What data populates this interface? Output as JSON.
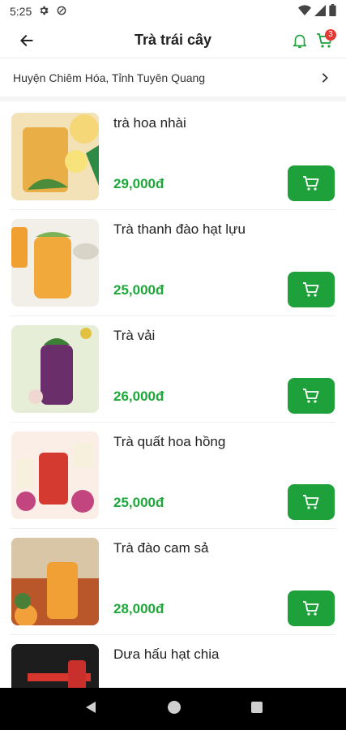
{
  "status_bar": {
    "time": "5:25"
  },
  "header": {
    "title": "Trà trái cây",
    "cart_count": "3"
  },
  "location": {
    "text": "Huyện Chiêm Hóa, Tỉnh Tuyên Quang"
  },
  "products": [
    {
      "name": "trà hoa nhài",
      "price": "29,000đ"
    },
    {
      "name": "Trà thanh đào hạt lựu",
      "price": "25,000đ"
    },
    {
      "name": "Trà vải",
      "price": "26,000đ"
    },
    {
      "name": "Trà quất hoa hồng",
      "price": "25,000đ"
    },
    {
      "name": "Trà đào cam sả",
      "price": "28,000đ"
    },
    {
      "name": "Dưa hấu hạt chia",
      "price": ""
    }
  ],
  "colors": {
    "accent": "#1ea13a",
    "price": "#1fa83a",
    "badge": "#e53935"
  }
}
